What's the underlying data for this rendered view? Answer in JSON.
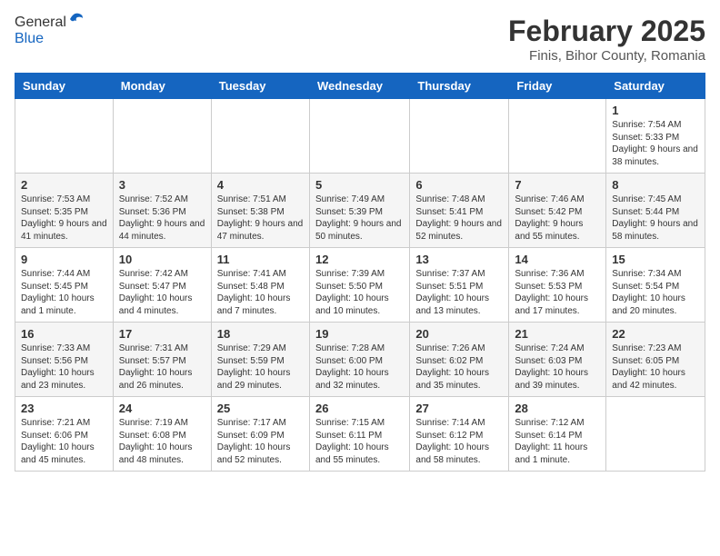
{
  "header": {
    "logo_general": "General",
    "logo_blue": "Blue",
    "main_title": "February 2025",
    "sub_title": "Finis, Bihor County, Romania"
  },
  "weekdays": [
    "Sunday",
    "Monday",
    "Tuesday",
    "Wednesday",
    "Thursday",
    "Friday",
    "Saturday"
  ],
  "weeks": [
    [
      {
        "day": "",
        "info": ""
      },
      {
        "day": "",
        "info": ""
      },
      {
        "day": "",
        "info": ""
      },
      {
        "day": "",
        "info": ""
      },
      {
        "day": "",
        "info": ""
      },
      {
        "day": "",
        "info": ""
      },
      {
        "day": "1",
        "info": "Sunrise: 7:54 AM\nSunset: 5:33 PM\nDaylight: 9 hours and 38 minutes."
      }
    ],
    [
      {
        "day": "2",
        "info": "Sunrise: 7:53 AM\nSunset: 5:35 PM\nDaylight: 9 hours and 41 minutes."
      },
      {
        "day": "3",
        "info": "Sunrise: 7:52 AM\nSunset: 5:36 PM\nDaylight: 9 hours and 44 minutes."
      },
      {
        "day": "4",
        "info": "Sunrise: 7:51 AM\nSunset: 5:38 PM\nDaylight: 9 hours and 47 minutes."
      },
      {
        "day": "5",
        "info": "Sunrise: 7:49 AM\nSunset: 5:39 PM\nDaylight: 9 hours and 50 minutes."
      },
      {
        "day": "6",
        "info": "Sunrise: 7:48 AM\nSunset: 5:41 PM\nDaylight: 9 hours and 52 minutes."
      },
      {
        "day": "7",
        "info": "Sunrise: 7:46 AM\nSunset: 5:42 PM\nDaylight: 9 hours and 55 minutes."
      },
      {
        "day": "8",
        "info": "Sunrise: 7:45 AM\nSunset: 5:44 PM\nDaylight: 9 hours and 58 minutes."
      }
    ],
    [
      {
        "day": "9",
        "info": "Sunrise: 7:44 AM\nSunset: 5:45 PM\nDaylight: 10 hours and 1 minute."
      },
      {
        "day": "10",
        "info": "Sunrise: 7:42 AM\nSunset: 5:47 PM\nDaylight: 10 hours and 4 minutes."
      },
      {
        "day": "11",
        "info": "Sunrise: 7:41 AM\nSunset: 5:48 PM\nDaylight: 10 hours and 7 minutes."
      },
      {
        "day": "12",
        "info": "Sunrise: 7:39 AM\nSunset: 5:50 PM\nDaylight: 10 hours and 10 minutes."
      },
      {
        "day": "13",
        "info": "Sunrise: 7:37 AM\nSunset: 5:51 PM\nDaylight: 10 hours and 13 minutes."
      },
      {
        "day": "14",
        "info": "Sunrise: 7:36 AM\nSunset: 5:53 PM\nDaylight: 10 hours and 17 minutes."
      },
      {
        "day": "15",
        "info": "Sunrise: 7:34 AM\nSunset: 5:54 PM\nDaylight: 10 hours and 20 minutes."
      }
    ],
    [
      {
        "day": "16",
        "info": "Sunrise: 7:33 AM\nSunset: 5:56 PM\nDaylight: 10 hours and 23 minutes."
      },
      {
        "day": "17",
        "info": "Sunrise: 7:31 AM\nSunset: 5:57 PM\nDaylight: 10 hours and 26 minutes."
      },
      {
        "day": "18",
        "info": "Sunrise: 7:29 AM\nSunset: 5:59 PM\nDaylight: 10 hours and 29 minutes."
      },
      {
        "day": "19",
        "info": "Sunrise: 7:28 AM\nSunset: 6:00 PM\nDaylight: 10 hours and 32 minutes."
      },
      {
        "day": "20",
        "info": "Sunrise: 7:26 AM\nSunset: 6:02 PM\nDaylight: 10 hours and 35 minutes."
      },
      {
        "day": "21",
        "info": "Sunrise: 7:24 AM\nSunset: 6:03 PM\nDaylight: 10 hours and 39 minutes."
      },
      {
        "day": "22",
        "info": "Sunrise: 7:23 AM\nSunset: 6:05 PM\nDaylight: 10 hours and 42 minutes."
      }
    ],
    [
      {
        "day": "23",
        "info": "Sunrise: 7:21 AM\nSunset: 6:06 PM\nDaylight: 10 hours and 45 minutes."
      },
      {
        "day": "24",
        "info": "Sunrise: 7:19 AM\nSunset: 6:08 PM\nDaylight: 10 hours and 48 minutes."
      },
      {
        "day": "25",
        "info": "Sunrise: 7:17 AM\nSunset: 6:09 PM\nDaylight: 10 hours and 52 minutes."
      },
      {
        "day": "26",
        "info": "Sunrise: 7:15 AM\nSunset: 6:11 PM\nDaylight: 10 hours and 55 minutes."
      },
      {
        "day": "27",
        "info": "Sunrise: 7:14 AM\nSunset: 6:12 PM\nDaylight: 10 hours and 58 minutes."
      },
      {
        "day": "28",
        "info": "Sunrise: 7:12 AM\nSunset: 6:14 PM\nDaylight: 11 hours and 1 minute."
      },
      {
        "day": "",
        "info": ""
      }
    ]
  ]
}
